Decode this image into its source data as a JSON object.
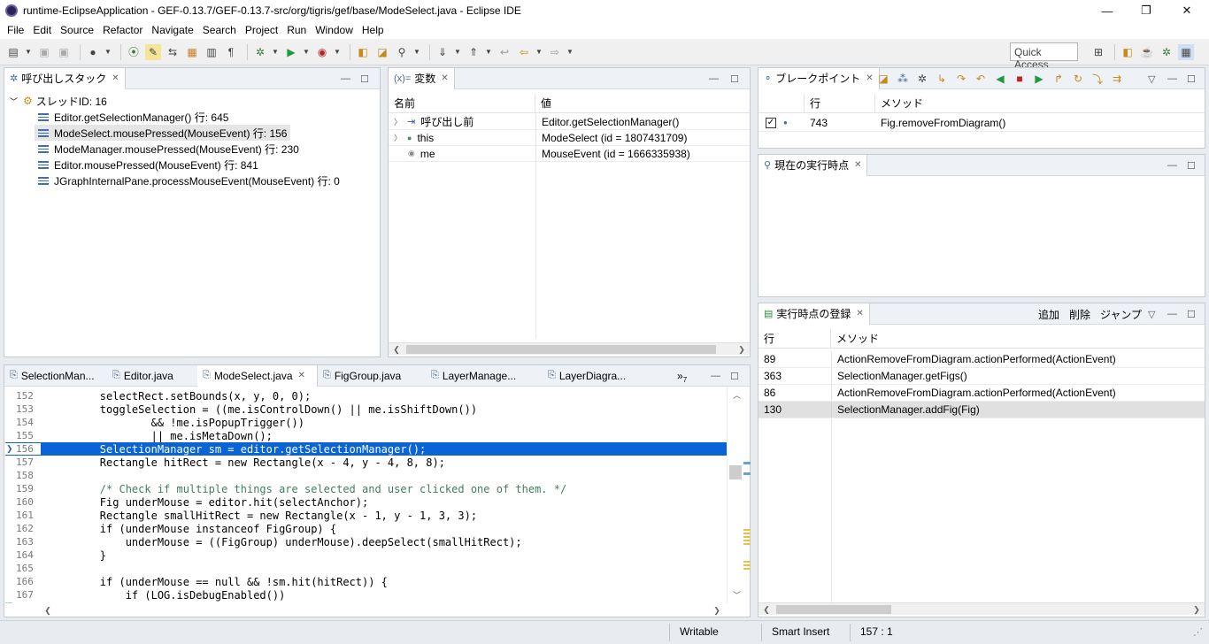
{
  "window": {
    "title": "runtime-EclipseApplication - GEF-0.13.7/GEF-0.13.7-src/org/tigris/gef/base/ModeSelect.java - Eclipse IDE",
    "minimize": "—",
    "maximize": "❐",
    "close": "✕"
  },
  "menu": [
    "File",
    "Edit",
    "Source",
    "Refactor",
    "Navigate",
    "Search",
    "Project",
    "Run",
    "Window",
    "Help"
  ],
  "toolbar": {
    "quick_access": "Quick Access"
  },
  "callstack": {
    "tab_label": "呼び出しスタック",
    "thread": "スレッドID: 16",
    "frames": [
      "Editor.getSelectionManager() 行: 645",
      "ModeSelect.mousePressed(MouseEvent) 行: 156",
      "ModeManager.mousePressed(MouseEvent) 行: 230",
      "Editor.mousePressed(MouseEvent) 行: 841",
      "JGraphInternalPane.processMouseEvent(MouseEvent) 行: 0"
    ]
  },
  "variables": {
    "tab_prefix": "(x)=",
    "tab_label": "変数",
    "col_name": "名前",
    "col_value": "値",
    "rows": [
      {
        "name": "呼び出し前",
        "value": "Editor.getSelectionManager()"
      },
      {
        "name": "this",
        "value": "ModeSelect (id = 1807431709)"
      },
      {
        "name": "me",
        "value": "MouseEvent (id = 1666335938)"
      }
    ]
  },
  "breakpoints": {
    "tab_label": "ブレークポイント",
    "col_line": "行",
    "col_method": "メソッド",
    "rows": [
      {
        "line": "743",
        "method": "Fig.removeFromDiagram()"
      }
    ]
  },
  "current_point": {
    "tab_label": "現在の実行時点"
  },
  "registered_points": {
    "tab_label": "実行時点の登録",
    "add": "追加",
    "remove": "削除",
    "jump": "ジャンプ",
    "col_line": "行",
    "col_method": "メソッド",
    "rows": [
      {
        "line": "89",
        "method": "ActionRemoveFromDiagram.actionPerformed(ActionEvent)"
      },
      {
        "line": "363",
        "method": "SelectionManager.getFigs()"
      },
      {
        "line": "86",
        "method": "ActionRemoveFromDiagram.actionPerformed(ActionEvent)"
      },
      {
        "line": "130",
        "method": "SelectionManager.addFig(Fig)"
      }
    ]
  },
  "editor": {
    "tabs": [
      "SelectionMan...",
      "Editor.java",
      "ModeSelect.java",
      "FigGroup.java",
      "LayerManage...",
      "LayerDiagra..."
    ],
    "overflow": "»",
    "overflow_count": "7",
    "lines": [
      {
        "n": "152",
        "code": "        selectRect.setBounds(x, y, 0, 0);"
      },
      {
        "n": "153",
        "code": "        toggleSelection = ((me.isControlDown() || me.isShiftDown())"
      },
      {
        "n": "154",
        "code": "                && !me.isPopupTrigger())"
      },
      {
        "n": "155",
        "code": "                || me.isMetaDown();"
      },
      {
        "n": "156",
        "code": "        SelectionManager sm = editor.getSelectionManager();"
      },
      {
        "n": "157",
        "code": "        Rectangle hitRect = new Rectangle(x - 4, y - 4, 8, 8);"
      },
      {
        "n": "158",
        "code": ""
      },
      {
        "n": "159",
        "code": "        /* Check if multiple things are selected and user clicked one of them. */"
      },
      {
        "n": "160",
        "code": "        Fig underMouse = editor.hit(selectAnchor);"
      },
      {
        "n": "161",
        "code": "        Rectangle smallHitRect = new Rectangle(x - 1, y - 1, 3, 3);"
      },
      {
        "n": "162",
        "code": "        if (underMouse instanceof FigGroup) {"
      },
      {
        "n": "163",
        "code": "            underMouse = ((FigGroup) underMouse).deepSelect(smallHitRect);"
      },
      {
        "n": "164",
        "code": "        }"
      },
      {
        "n": "165",
        "code": ""
      },
      {
        "n": "166",
        "code": "        if (underMouse == null && !sm.hit(hitRect)) {"
      },
      {
        "n": "167",
        "code": "            if (LOG.isDebugEnabled())"
      }
    ]
  },
  "status": {
    "writable": "Writable",
    "insert_mode": "Smart Insert",
    "position": "157 : 1"
  }
}
